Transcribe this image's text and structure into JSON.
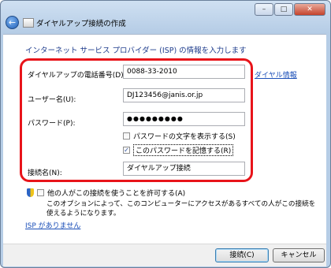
{
  "window": {
    "title": "ダイヤルアップ接続の作成",
    "caption_buttons": {
      "minimize": "–",
      "maximize": "□",
      "close": "✕"
    }
  },
  "heading": "インターネット サービス プロバイダー (ISP) の情報を入力します",
  "form": {
    "phone_label": "ダイヤルアップの電話番号(D):",
    "phone_value": "0088-33-2010",
    "dial_info_link": "ダイヤル情報",
    "user_label": "ユーザー名(U):",
    "user_value": "DJ123456@janis.or.jp",
    "password_label": "パスワード(P):",
    "password_value": "●●●●●●●●●",
    "show_password_label": "パスワードの文字を表示する(S)",
    "show_password_checked": false,
    "remember_password_label": "このパスワードを記憶する(R)",
    "remember_password_checked": true,
    "connection_name_label": "接続名(N):",
    "connection_name_value": "ダイヤルアップ接続"
  },
  "allow_others": {
    "label": "他の人がこの接続を使うことを許可する(A)",
    "checked": false,
    "description": "このオプションによって、このコンピューターにアクセスがあるすべての人がこの接続を使えるようになります。"
  },
  "no_isp_link": "ISP がありません",
  "buttons": {
    "connect": "接続(C)",
    "cancel": "キャンセル"
  },
  "colors": {
    "highlight": "#e8141a",
    "link": "#1b4fb8",
    "heading": "#1e3c8c"
  }
}
